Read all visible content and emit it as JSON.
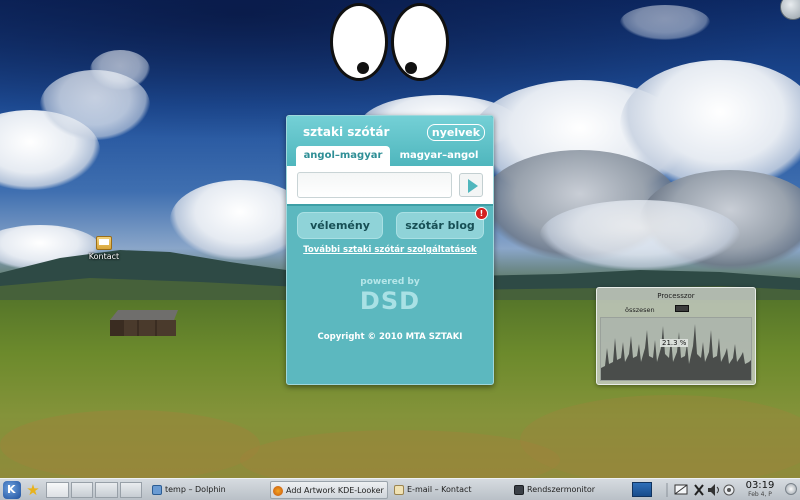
{
  "widget": {
    "title": "sztaki szótár",
    "languages_button": "nyelvek",
    "tabs": [
      {
        "label": "angol–magyar",
        "active": true
      },
      {
        "label": "magyar–angol",
        "active": false
      }
    ],
    "search_value": "",
    "buttons": {
      "opinion": "vélemény",
      "blog": "szótár blog"
    },
    "notification_badge": "!",
    "more_services_link": "További sztaki szótár szolgáltatások",
    "powered_by": "powered by",
    "logo_text": "DSD",
    "copyright": "Copyright © 2010 MTA SZTAKI",
    "colors": {
      "accent": "#5cb8bf",
      "header": "#4fb6bd",
      "badge": "#d42020"
    }
  },
  "desktop": {
    "icon_label": "Kontact"
  },
  "processor_widget": {
    "title": "Processzor",
    "legend_label": "összesen",
    "value_label": "21.3 %"
  },
  "taskbar": {
    "tasks": [
      {
        "label": "temp – Dolphin",
        "icon": "dolphin-icon",
        "active": false
      },
      {
        "label": "Add Artwork KDE-Looker",
        "icon": "firefox-icon",
        "active": true
      },
      {
        "label": "E-mail – Kontact",
        "icon": "kontact-icon",
        "active": false
      },
      {
        "label": "Rendszermonitor",
        "icon": "monitor-icon",
        "active": false
      }
    ],
    "clock_time": "03:19",
    "clock_date": "Feb 4, P"
  }
}
